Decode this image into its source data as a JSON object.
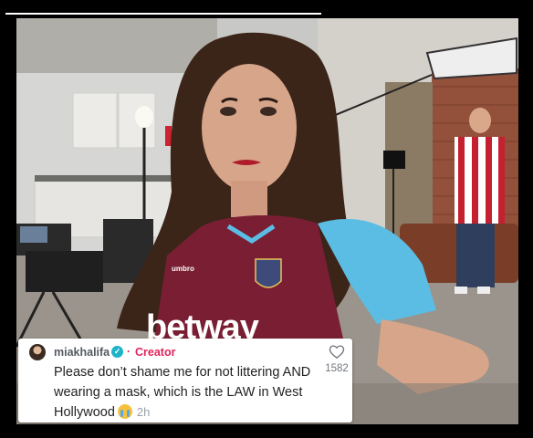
{
  "comment": {
    "username": "miakhalifa",
    "badge_icon": "verified-check-icon",
    "separator": "·",
    "role": "Creator",
    "text": "Please don’t shame me for not littering AND wearing a mask, which is the LAW in West Hollywood",
    "emoji_icon": "crying-face-emoji",
    "time": "2h",
    "like_icon": "heart-outline-icon",
    "like_count": "1582"
  },
  "photo": {
    "jersey_sponsor": "betway",
    "jersey_brand": "umbro",
    "colors": {
      "claret": "#7a1f33",
      "sky_blue": "#5cbde4",
      "brick": "#8a4a33"
    }
  }
}
